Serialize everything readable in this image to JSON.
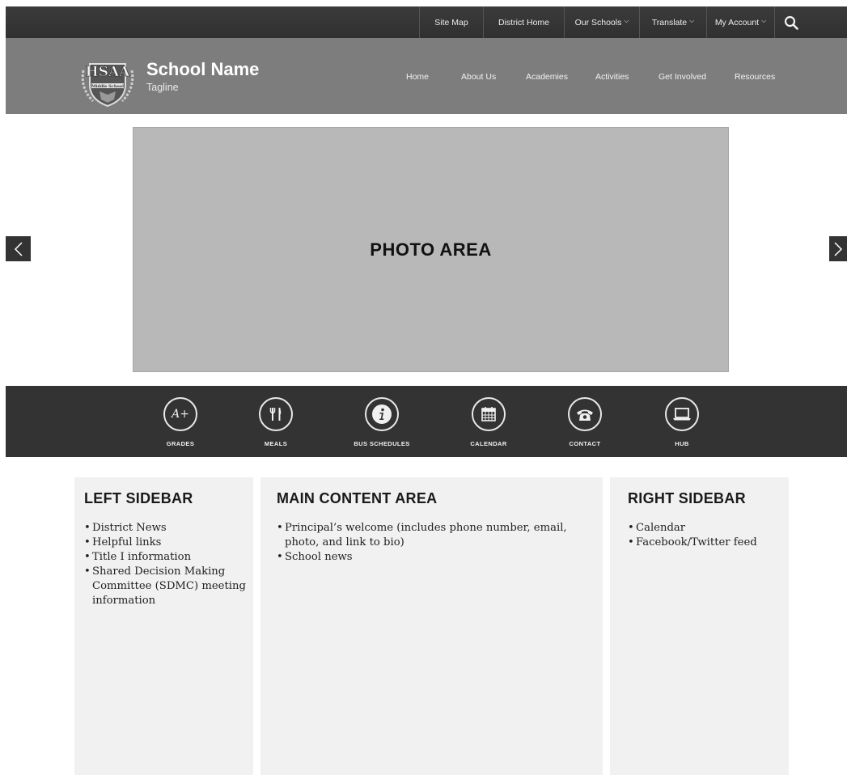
{
  "utility_nav": {
    "items": [
      {
        "label": "Site Map",
        "dropdown": false
      },
      {
        "label": "District Home",
        "dropdown": false
      },
      {
        "label": "Our Schools",
        "dropdown": true
      },
      {
        "label": "Translate",
        "dropdown": true
      },
      {
        "label": "My Account",
        "dropdown": true
      }
    ],
    "search_icon": "search-icon"
  },
  "header": {
    "logo": {
      "top_text": "HSAA",
      "band_text": "Middle School",
      "icon": "crest-logo"
    },
    "school_name": "School Name",
    "tagline": "Tagline"
  },
  "main_nav": {
    "items": [
      "Home",
      "About Us",
      "Academies",
      "Activities",
      "Get Involved",
      "Resources"
    ]
  },
  "carousel": {
    "photo_label": "PHOTO AREA",
    "prev_icon": "chevron-left-icon",
    "next_icon": "chevron-right-icon"
  },
  "quick_links": [
    {
      "label": "GRADES",
      "icon": "grades-icon",
      "glyph": "A+"
    },
    {
      "label": "MEALS",
      "icon": "utensils-icon"
    },
    {
      "label": "BUS SCHEDULES",
      "icon": "info-icon"
    },
    {
      "label": "CALENDAR",
      "icon": "calendar-icon"
    },
    {
      "label": "CONTACT",
      "icon": "phone-icon"
    },
    {
      "label": "HUB",
      "icon": "laptop-icon"
    }
  ],
  "columns": {
    "left": {
      "title": "LEFT SIDEBAR",
      "items": [
        "District News",
        "Helpful links",
        "Title I information",
        "Shared Decision Making Committee (SDMC) meeting information"
      ]
    },
    "main": {
      "title": "MAIN CONTENT AREA",
      "items": [
        "Principal’s welcome (includes phone number, email, photo, and link to bio)",
        "School news"
      ]
    },
    "right": {
      "title": "RIGHT SIDEBAR",
      "items": [
        "Calendar",
        "Facebook/Twitter feed"
      ]
    }
  },
  "colors": {
    "utility_bar": "#333333",
    "header": "#7d7d7d",
    "photo_area": "#b8b8b8",
    "quick_bar": "#333333",
    "column_bg": "#f1f1f1"
  }
}
